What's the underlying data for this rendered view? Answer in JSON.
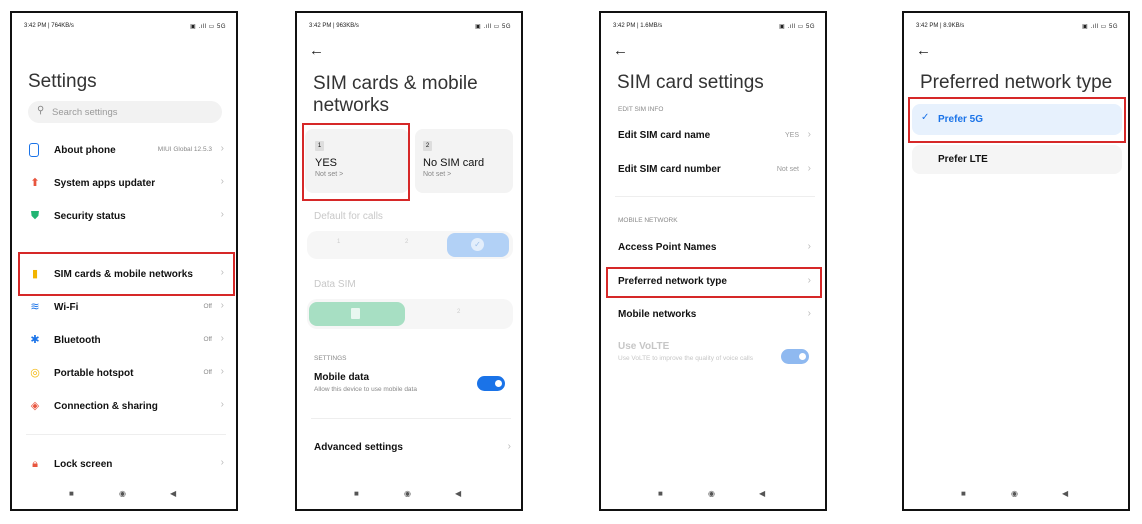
{
  "nav_icons": {
    "recent": "■",
    "home": "◉",
    "back": "◀"
  },
  "screen1": {
    "status_time": "3:42 PM | 764KB/s",
    "status_icons": "▣ .ıll ▭ 5G",
    "title": "Settings",
    "search_placeholder": "Search settings",
    "items": [
      {
        "label": "About phone",
        "value": "MIUI Global 12.5.3"
      },
      {
        "label": "System apps updater",
        "value": ""
      },
      {
        "label": "Security status",
        "value": ""
      },
      {
        "label": "SIM cards & mobile networks",
        "value": ""
      },
      {
        "label": "Wi-Fi",
        "value": "Off"
      },
      {
        "label": "Bluetooth",
        "value": "Off"
      },
      {
        "label": "Portable hotspot",
        "value": "Off"
      },
      {
        "label": "Connection & sharing",
        "value": ""
      },
      {
        "label": "Lock screen",
        "value": ""
      }
    ]
  },
  "screen2": {
    "status_time": "3:42 PM | 963KB/s",
    "status_icons": "▣ .ıll ▭ 5G",
    "title_line1": "SIM cards & mobile",
    "title_line2": "networks",
    "sim1": {
      "slot": "1",
      "name": "YES",
      "sub": "Not set >"
    },
    "sim2": {
      "slot": "2",
      "name": "No SIM card",
      "sub": "Not set >"
    },
    "default_calls": "Default for calls",
    "calls_opts": [
      "1",
      "2"
    ],
    "data_sim": "Data SIM",
    "data_opts": [
      "2"
    ],
    "settings_header": "SETTINGS",
    "mobile_data": "Mobile data",
    "mobile_data_sub": "Allow this device to use mobile data",
    "advanced": "Advanced settings"
  },
  "screen3": {
    "status_time": "3:42 PM | 1.6MB/s",
    "status_icons": "▣ .ıll ▭ 5G",
    "title": "SIM card settings",
    "sec1": "EDIT SIM INFO",
    "edit_name": "Edit SIM card name",
    "edit_name_val": "YES",
    "edit_number": "Edit SIM card number",
    "edit_number_val": "Not set",
    "sec2": "MOBILE NETWORK",
    "apn": "Access Point Names",
    "pref": "Preferred network type",
    "mobile_networks": "Mobile networks",
    "volte": "Use VoLTE",
    "volte_sub": "Use VoLTE to improve the quality of voice calls"
  },
  "screen4": {
    "status_time": "3:42 PM | 8.9KB/s",
    "status_icons": "▣ .ıll ▭ 5G",
    "title": "Preferred network type",
    "opt1": "Prefer 5G",
    "opt2": "Prefer LTE"
  }
}
